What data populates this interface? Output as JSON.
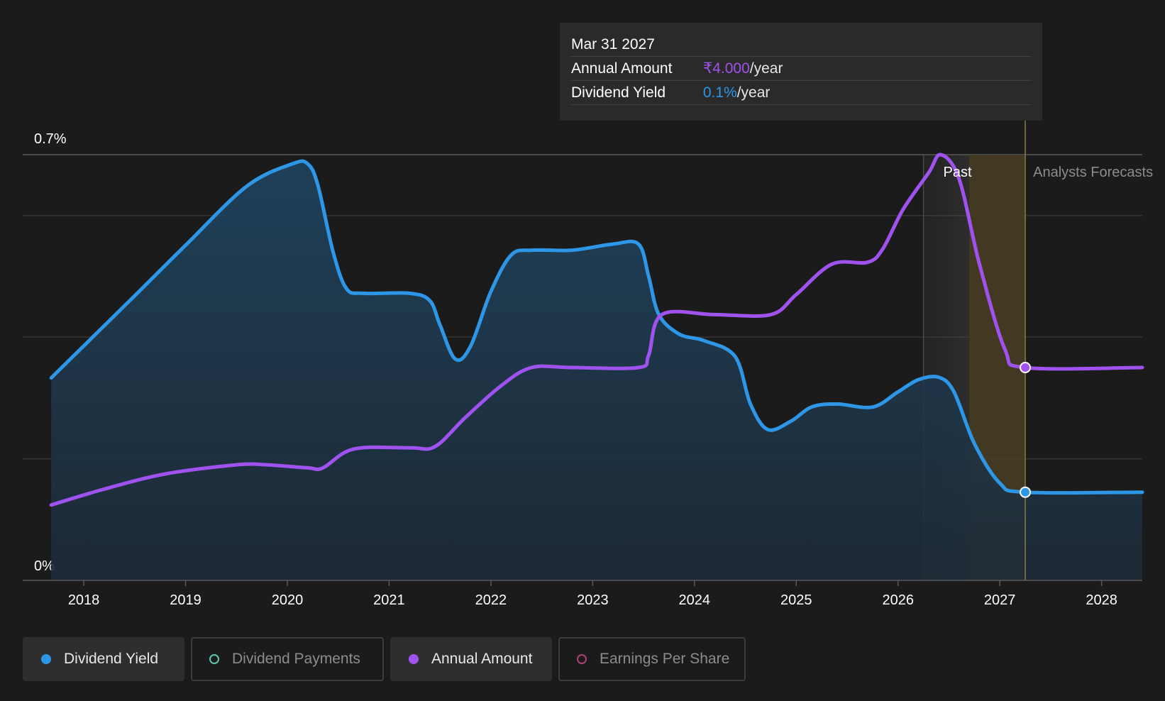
{
  "colors": {
    "dividend_yield": "#2e96e6",
    "annual_amount": "#9f52ed",
    "dividend_payments": "#5dc4b0",
    "earnings_per_share": "#b0407a",
    "background": "#1b1b1b",
    "forecast_band": "#4a3e24"
  },
  "tooltip": {
    "date": "Mar 31 2027",
    "rows": [
      {
        "label": "Annual Amount",
        "value": "₹4.000",
        "unit": "/year",
        "color": "#9f52ed"
      },
      {
        "label": "Dividend Yield",
        "value": "0.1%",
        "unit": "/year",
        "color": "#2e96e6"
      }
    ]
  },
  "legend": {
    "items": [
      {
        "label": "Dividend Yield",
        "active": true,
        "color": "#2e96e6",
        "filled": true
      },
      {
        "label": "Dividend Payments",
        "active": false,
        "color": "#5dc4b0",
        "filled": false
      },
      {
        "label": "Annual Amount",
        "active": true,
        "color": "#9f52ed",
        "filled": true
      },
      {
        "label": "Earnings Per Share",
        "active": false,
        "color": "#b0407a",
        "filled": false
      }
    ]
  },
  "chart_data": {
    "type": "line",
    "title": "",
    "xlabel": "",
    "ylabel": "",
    "xlim": [
      2017.4,
      2028.4
    ],
    "ylim": [
      0,
      0.7
    ],
    "y_tick_labels": [
      {
        "value": 0.7,
        "label": "0.7%"
      },
      {
        "value": 0,
        "label": "0%"
      }
    ],
    "gridlines_y": [
      0.2,
      0.4,
      0.6,
      0.7
    ],
    "x_ticks": [
      2018,
      2019,
      2020,
      2021,
      2022,
      2023,
      2024,
      2025,
      2026,
      2027,
      2028
    ],
    "past_label": "Past",
    "forecast_label": "Analysts Forecasts",
    "past_start": 2026.25,
    "forecast_start": 2026.7,
    "forecast_end": 2027.25,
    "cursor_x": 2027.25,
    "series": [
      {
        "name": "Dividend Yield",
        "area": true,
        "points": [
          [
            2017.68,
            0.333
          ],
          [
            2018.5,
            0.468
          ],
          [
            2019.0,
            0.551
          ],
          [
            2019.6,
            0.648
          ],
          [
            2020.05,
            0.685
          ],
          [
            2020.2,
            0.685
          ],
          [
            2020.3,
            0.65
          ],
          [
            2020.45,
            0.54
          ],
          [
            2020.58,
            0.48
          ],
          [
            2020.75,
            0.472
          ],
          [
            2021.2,
            0.472
          ],
          [
            2021.4,
            0.46
          ],
          [
            2021.5,
            0.42
          ],
          [
            2021.65,
            0.364
          ],
          [
            2021.8,
            0.385
          ],
          [
            2022.0,
            0.475
          ],
          [
            2022.2,
            0.535
          ],
          [
            2022.4,
            0.543
          ],
          [
            2022.8,
            0.543
          ],
          [
            2023.2,
            0.553
          ],
          [
            2023.45,
            0.553
          ],
          [
            2023.55,
            0.5
          ],
          [
            2023.65,
            0.437
          ],
          [
            2023.85,
            0.405
          ],
          [
            2024.1,
            0.394
          ],
          [
            2024.4,
            0.368
          ],
          [
            2024.55,
            0.29
          ],
          [
            2024.72,
            0.248
          ],
          [
            2024.95,
            0.262
          ],
          [
            2025.15,
            0.285
          ],
          [
            2025.4,
            0.29
          ],
          [
            2025.75,
            0.285
          ],
          [
            2026.0,
            0.31
          ],
          [
            2026.2,
            0.33
          ],
          [
            2026.4,
            0.334
          ],
          [
            2026.55,
            0.31
          ],
          [
            2026.75,
            0.225
          ],
          [
            2027.0,
            0.16
          ],
          [
            2027.25,
            0.145
          ],
          [
            2028.4,
            0.145
          ]
        ]
      },
      {
        "name": "Annual Amount",
        "area": false,
        "points": [
          [
            2017.68,
            0.124
          ],
          [
            2018.2,
            0.15
          ],
          [
            2018.8,
            0.175
          ],
          [
            2019.5,
            0.19
          ],
          [
            2019.8,
            0.19
          ],
          [
            2020.2,
            0.185
          ],
          [
            2020.35,
            0.185
          ],
          [
            2020.65,
            0.216
          ],
          [
            2021.2,
            0.218
          ],
          [
            2021.45,
            0.22
          ],
          [
            2021.75,
            0.268
          ],
          [
            2022.1,
            0.32
          ],
          [
            2022.4,
            0.35
          ],
          [
            2022.8,
            0.35
          ],
          [
            2023.45,
            0.35
          ],
          [
            2023.55,
            0.37
          ],
          [
            2023.68,
            0.437
          ],
          [
            2024.2,
            0.437
          ],
          [
            2024.75,
            0.437
          ],
          [
            2025.0,
            0.47
          ],
          [
            2025.35,
            0.52
          ],
          [
            2025.7,
            0.523
          ],
          [
            2025.85,
            0.545
          ],
          [
            2026.05,
            0.61
          ],
          [
            2026.3,
            0.67
          ],
          [
            2026.42,
            0.7
          ],
          [
            2026.6,
            0.66
          ],
          [
            2026.8,
            0.52
          ],
          [
            2027.05,
            0.38
          ],
          [
            2027.25,
            0.35
          ],
          [
            2028.4,
            0.35
          ]
        ]
      }
    ]
  }
}
